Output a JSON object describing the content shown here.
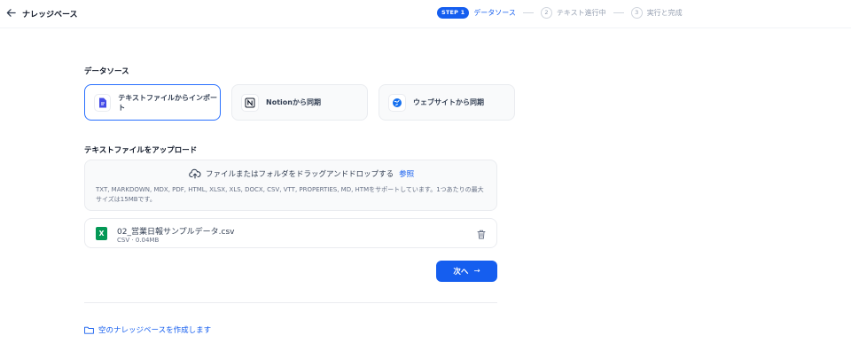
{
  "header": {
    "back_icon": "arrow-left-icon",
    "title": "ナレッジベース"
  },
  "steps": [
    {
      "badge": "STEP 1",
      "label": "データソース",
      "state": "active"
    },
    {
      "number": "2",
      "label": "テキスト進行中",
      "state": "inactive"
    },
    {
      "number": "3",
      "label": "実行と完成",
      "state": "inactive"
    }
  ],
  "data_source": {
    "title": "データソース",
    "options": [
      {
        "label": "テキストファイルからインポート",
        "icon": "file-text-icon",
        "selected": true
      },
      {
        "label": "Notionから同期",
        "icon": "notion-icon",
        "selected": false
      },
      {
        "label": "ウェブサイトから同期",
        "icon": "globe-icon",
        "selected": false
      }
    ]
  },
  "upload": {
    "title": "テキストファイルをアップロード",
    "drop_text": "ファイルまたはフォルダをドラッグアンドドロップする",
    "browse_label": "参照",
    "supported": "TXT, MARKDOWN, MDX, PDF, HTML, XLSX, XLS, DOCX, CSV, VTT, PROPERTIES, MD, HTMをサポートしています。1つあたりの最大サイズは15MBです。"
  },
  "file": {
    "name": "02_営業日報サンプルデータ.csv",
    "type": "CSV",
    "size": "0.04MB",
    "icon_letter": "X"
  },
  "next_button": {
    "label": "次へ",
    "arrow": "→"
  },
  "empty_kb_link": {
    "label": "空のナレッジベースを作成します",
    "icon": "folder-icon"
  },
  "colors": {
    "accent": "#155eef",
    "excel_green": "#039855"
  }
}
